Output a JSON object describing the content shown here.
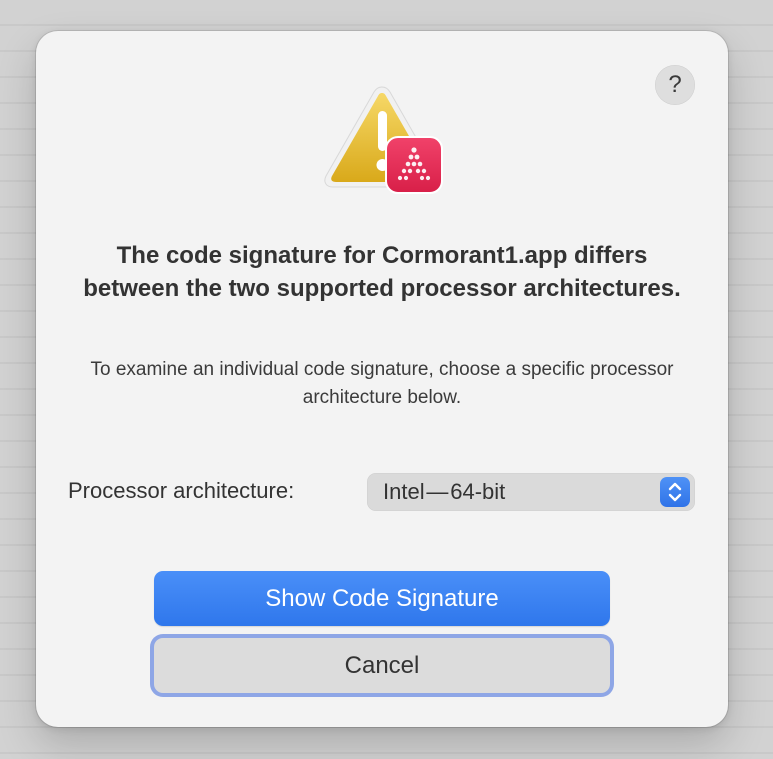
{
  "dialog": {
    "help_label": "?",
    "icon": "warning-triangle-with-app-badge-icon",
    "title": "The code signature for Cormorant1.app differs between the two supported processor architectures.",
    "message": "To examine an individual code signature, choose a specific processor architecture below.",
    "field": {
      "label": "Processor architecture:",
      "selected": "Intel — 64-bit"
    },
    "buttons": {
      "primary": "Show Code Signature",
      "cancel": "Cancel"
    }
  },
  "colors": {
    "accent": "#2f77ec",
    "warning": "#e5b82b",
    "badge": "#e02a52",
    "focus_ring": "#8ea6e6"
  }
}
